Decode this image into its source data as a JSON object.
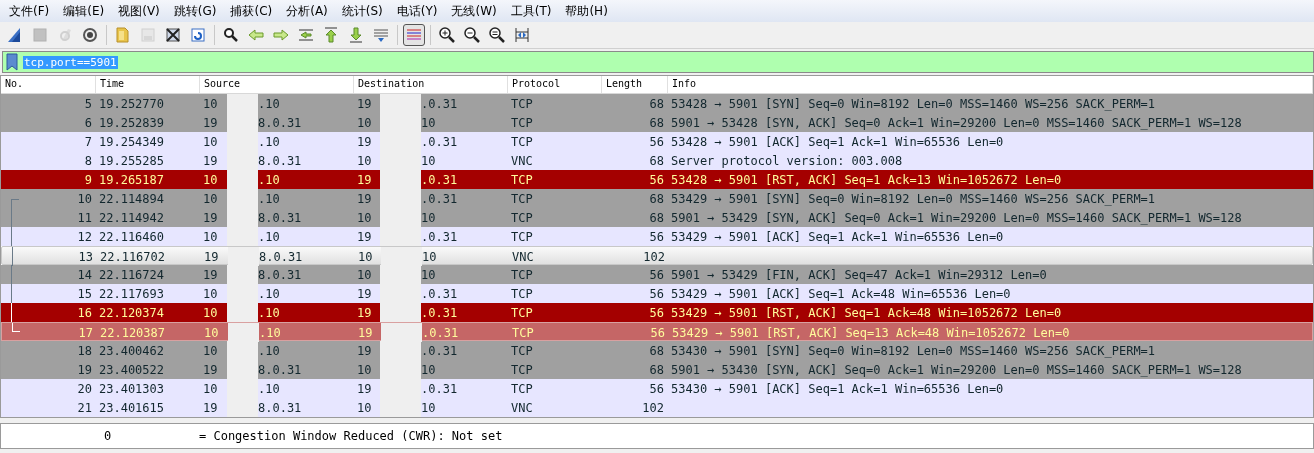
{
  "menu": [
    {
      "label": "文件(F)"
    },
    {
      "label": "编辑(E)"
    },
    {
      "label": "视图(V)"
    },
    {
      "label": "跳转(G)"
    },
    {
      "label": "捕获(C)"
    },
    {
      "label": "分析(A)"
    },
    {
      "label": "统计(S)"
    },
    {
      "label": "电话(Y)"
    },
    {
      "label": "无线(W)"
    },
    {
      "label": "工具(T)"
    },
    {
      "label": "帮助(H)"
    }
  ],
  "toolbar": [
    {
      "kind": "shark",
      "disabled": false,
      "pressed": false
    },
    {
      "kind": "stop",
      "disabled": true,
      "pressed": false
    },
    {
      "kind": "restart",
      "disabled": true,
      "pressed": false
    },
    {
      "kind": "options",
      "disabled": false,
      "pressed": false
    },
    {
      "kind": "sep"
    },
    {
      "kind": "open",
      "disabled": false,
      "pressed": false
    },
    {
      "kind": "save",
      "disabled": true,
      "pressed": false
    },
    {
      "kind": "close",
      "disabled": false,
      "pressed": false
    },
    {
      "kind": "reload",
      "disabled": false,
      "pressed": false
    },
    {
      "kind": "sep"
    },
    {
      "kind": "find",
      "disabled": false,
      "pressed": false
    },
    {
      "kind": "back",
      "disabled": false,
      "pressed": false
    },
    {
      "kind": "forward",
      "disabled": false,
      "pressed": false
    },
    {
      "kind": "goto",
      "disabled": false,
      "pressed": false
    },
    {
      "kind": "first",
      "disabled": false,
      "pressed": false
    },
    {
      "kind": "last",
      "disabled": false,
      "pressed": false
    },
    {
      "kind": "autoscroll",
      "disabled": false,
      "pressed": false
    },
    {
      "kind": "sep"
    },
    {
      "kind": "colorize",
      "disabled": false,
      "pressed": true
    },
    {
      "kind": "sep"
    },
    {
      "kind": "zoomin",
      "disabled": false,
      "pressed": false
    },
    {
      "kind": "zoomout",
      "disabled": false,
      "pressed": false
    },
    {
      "kind": "zoomreset",
      "disabled": false,
      "pressed": false
    },
    {
      "kind": "resize",
      "disabled": false,
      "pressed": false
    }
  ],
  "filter": {
    "value": "tcp.port==5901",
    "text_selected": true,
    "valid": true
  },
  "table": {
    "columns": [
      "No.",
      "Time",
      "Source",
      "Destination",
      "Protocol",
      "Length",
      "Info"
    ],
    "rows": [
      {
        "no": "5",
        "time": "19.252770",
        "source": [
          "10",
          ".10"
        ],
        "destination": [
          "19",
          ".0.31"
        ],
        "protocol": "TCP",
        "length": "68",
        "info": "53428 → 5901 [SYN] Seq=0 Win=8192 Len=0 MSS=1460 WS=256 SACK_PERM=1",
        "kind": "syn",
        "selected": false,
        "hovered": false
      },
      {
        "no": "6",
        "time": "19.252839",
        "source": [
          "19",
          "8.0.31"
        ],
        "destination": [
          "10",
          "10"
        ],
        "protocol": "TCP",
        "length": "68",
        "info": "5901 → 53428 [SYN, ACK] Seq=0 Ack=1 Win=29200 Len=0 MSS=1460 SACK_PERM=1 WS=128",
        "kind": "syn",
        "selected": false,
        "hovered": false
      },
      {
        "no": "7",
        "time": "19.254349",
        "source": [
          "10",
          ".10"
        ],
        "destination": [
          "19",
          ".0.31"
        ],
        "protocol": "TCP",
        "length": "56",
        "info": "53428 → 5901 [ACK] Seq=1 Ack=1 Win=65536 Len=0",
        "kind": "normal",
        "selected": false,
        "hovered": false
      },
      {
        "no": "8",
        "time": "19.255285",
        "source": [
          "19",
          "8.0.31"
        ],
        "destination": [
          "10",
          "10"
        ],
        "protocol": "VNC",
        "length": "68",
        "info": "Server protocol version: 003.008",
        "kind": "normal",
        "selected": false,
        "hovered": false
      },
      {
        "no": "9",
        "time": "19.265187",
        "source": [
          "10",
          ".10"
        ],
        "destination": [
          "19",
          ".0.31"
        ],
        "protocol": "TCP",
        "length": "56",
        "info": "53428 → 5901 [RST, ACK] Seq=1 Ack=13 Win=1052672 Len=0",
        "kind": "rst",
        "selected": false,
        "hovered": false
      },
      {
        "no": "10",
        "time": "22.114894",
        "source": [
          "10",
          ".10"
        ],
        "destination": [
          "19",
          ".0.31"
        ],
        "protocol": "TCP",
        "length": "68",
        "info": "53429 → 5901 [SYN] Seq=0 Win=8192 Len=0 MSS=1460 WS=256 SACK_PERM=1",
        "kind": "syn",
        "selected": false,
        "hovered": false,
        "related": true
      },
      {
        "no": "11",
        "time": "22.114942",
        "source": [
          "19",
          "8.0.31"
        ],
        "destination": [
          "10",
          "10"
        ],
        "protocol": "TCP",
        "length": "68",
        "info": "5901 → 53429 [SYN, ACK] Seq=0 Ack=1 Win=29200 Len=0 MSS=1460 SACK_PERM=1 WS=128",
        "kind": "syn",
        "selected": false,
        "hovered": false,
        "related": true
      },
      {
        "no": "12",
        "time": "22.116460",
        "source": [
          "10",
          ".10"
        ],
        "destination": [
          "19",
          ".0.31"
        ],
        "protocol": "TCP",
        "length": "56",
        "info": "53429 → 5901 [ACK] Seq=1 Ack=1 Win=65536 Len=0",
        "kind": "normal",
        "selected": false,
        "hovered": false,
        "related": true
      },
      {
        "no": "13",
        "time": "22.116702",
        "source": [
          "19",
          "8.0.31"
        ],
        "destination": [
          "10",
          "10"
        ],
        "protocol": "VNC",
        "length": "102",
        "kind": "normal",
        "selected": false,
        "hovered": true,
        "related": true
      },
      {
        "no": "14",
        "time": "22.116724",
        "source": [
          "19",
          "8.0.31"
        ],
        "destination": [
          "10",
          "10"
        ],
        "protocol": "TCP",
        "length": "56",
        "info": "5901 → 53429 [FIN, ACK] Seq=47 Ack=1 Win=29312 Len=0",
        "kind": "syn",
        "selected": false,
        "hovered": false,
        "related": true
      },
      {
        "no": "15",
        "time": "22.117693",
        "source": [
          "10",
          ".10"
        ],
        "destination": [
          "19",
          ".0.31"
        ],
        "protocol": "TCP",
        "length": "56",
        "info": "53429 → 5901 [ACK] Seq=1 Ack=48 Win=65536 Len=0",
        "kind": "normal",
        "selected": false,
        "hovered": false,
        "related": true
      },
      {
        "no": "16",
        "time": "22.120374",
        "source": [
          "10",
          ".10"
        ],
        "destination": [
          "19",
          ".0.31"
        ],
        "protocol": "TCP",
        "length": "56",
        "info": "53429 → 5901 [RST, ACK] Seq=1 Ack=48 Win=1052672 Len=0",
        "kind": "rst",
        "selected": false,
        "hovered": false,
        "related": true
      },
      {
        "no": "17",
        "time": "22.120387",
        "source": [
          "10",
          ".10"
        ],
        "destination": [
          "19",
          ".0.31"
        ],
        "protocol": "TCP",
        "length": "56",
        "info": "53429 → 5901 [RST, ACK] Seq=13 Ack=48 Win=1052672 Len=0",
        "kind": "rst",
        "selected": true,
        "hovered": false,
        "related": true
      },
      {
        "no": "18",
        "time": "23.400462",
        "source": [
          "10",
          ".10"
        ],
        "destination": [
          "19",
          ".0.31"
        ],
        "protocol": "TCP",
        "length": "68",
        "info": "53430 → 5901 [SYN] Seq=0 Win=8192 Len=0 MSS=1460 WS=256 SACK_PERM=1",
        "kind": "syn",
        "selected": false,
        "hovered": false
      },
      {
        "no": "19",
        "time": "23.400522",
        "source": [
          "19",
          "8.0.31"
        ],
        "destination": [
          "10",
          "10"
        ],
        "protocol": "TCP",
        "length": "68",
        "info": "5901 → 53430 [SYN, ACK] Seq=0 Ack=1 Win=29200 Len=0 MSS=1460 SACK_PERM=1 WS=128",
        "kind": "syn",
        "selected": false,
        "hovered": false
      },
      {
        "no": "20",
        "time": "23.401303",
        "source": [
          "10",
          ".10"
        ],
        "destination": [
          "19",
          ".0.31"
        ],
        "protocol": "TCP",
        "length": "56",
        "info": "53430 → 5901 [ACK] Seq=1 Ack=1 Win=65536 Len=0",
        "kind": "normal",
        "selected": false,
        "hovered": false
      },
      {
        "no": "21",
        "time": "23.401615",
        "source": [
          "19",
          "8.0.31"
        ],
        "destination": [
          "10",
          "10"
        ],
        "protocol": "VNC",
        "length": "102",
        "kind": "normal",
        "selected": false,
        "hovered": false
      }
    ]
  },
  "details": {
    "bits": "0",
    "text": "= Congestion Window Reduced (CWR): Not set"
  }
}
